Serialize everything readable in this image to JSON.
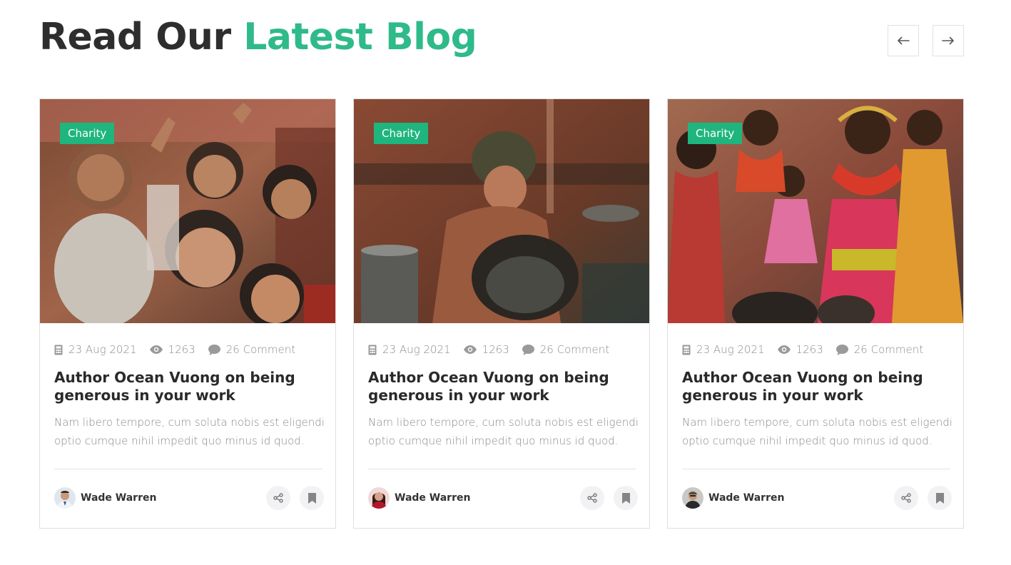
{
  "heading": {
    "part1": "Read Our ",
    "part2": "Latest Blog"
  },
  "nav": {
    "prev_icon": "arrow-left-icon",
    "next_icon": "arrow-right-icon"
  },
  "colors": {
    "accent": "#2fba8a",
    "tag_bg": "#1fb57e",
    "muted_text": "#8a8a8a"
  },
  "posts": [
    {
      "tag": "Charity",
      "date": "23 Aug 2021",
      "views": "1263",
      "comments": "26 Comment",
      "title": "Author Ocean Vuong on being generous in your work",
      "excerpt": "Nam libero tempore, cum soluta nobis est eligendi optio cumque nihil impedit quo minus id quod.",
      "author": "Wade Warren"
    },
    {
      "tag": "Charity",
      "date": "23 Aug 2021",
      "views": "1263",
      "comments": "26 Comment",
      "title": "Author Ocean Vuong on being generous in your work",
      "excerpt": "Nam libero tempore, cum soluta nobis est eligendi optio cumque nihil impedit quo minus id quod.",
      "author": "Wade Warren"
    },
    {
      "tag": "Charity",
      "date": "23 Aug 2021",
      "views": "1263",
      "comments": "26 Comment",
      "title": "Author Ocean Vuong on being generous in your work",
      "excerpt": "Nam libero tempore, cum soluta nobis est eligendi optio cumque nihil impedit quo minus id quod.",
      "author": "Wade Warren"
    }
  ],
  "icons": {
    "date": "calendar-icon",
    "views": "eye-icon",
    "comments": "comment-icon",
    "share": "share-icon",
    "bookmark": "bookmark-icon"
  }
}
